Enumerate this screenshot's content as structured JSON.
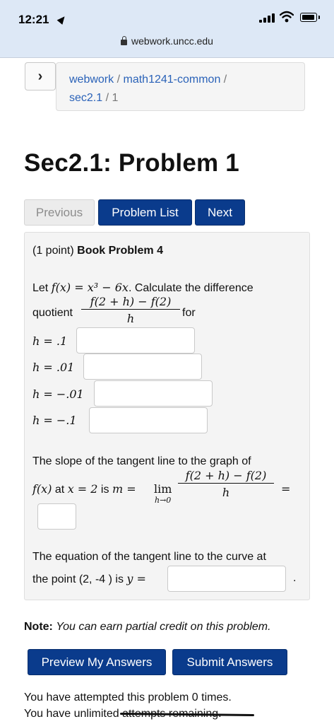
{
  "status_bar": {
    "time": "12:21"
  },
  "browser": {
    "url": "webwork.uncc.edu"
  },
  "breadcrumb": {
    "part1": "webwork",
    "part2": "math1241-common",
    "part3": "sec2.1",
    "part4": "1",
    "sep": "/"
  },
  "page": {
    "title": "Sec2.1: Problem 1"
  },
  "nav": {
    "previous": "Previous",
    "problem_list": "Problem List",
    "next": "Next"
  },
  "problem": {
    "points": "(1 point)",
    "name": "Book Problem 4",
    "let": "Let",
    "function": "f(x) = x³ − 6x",
    "calc": ". Calculate the difference",
    "quotient": "quotient",
    "frac_num": "f(2 + h) − f(2)",
    "frac_den": "h",
    "for": "for",
    "h_values": [
      "h = .1",
      "h = .01",
      "h = −.01",
      "h = −.1"
    ],
    "slope_line1": "The slope of the tangent line to the graph of",
    "fx": "f(x)",
    "at": "at",
    "x_eq": "x = 2",
    "is": "is",
    "m_eq": "m = ",
    "lim": "lim",
    "lim_sub": "h→0",
    "equals": "=",
    "tangent_line1": "The equation of the tangent line to the curve at",
    "tangent_line2": "the point (2, -4 ) is",
    "y_eq": "y =",
    "period": "."
  },
  "footer": {
    "note_label": "Note:",
    "note_text": "You can earn partial credit on this problem.",
    "preview_button": "Preview My Answers",
    "submit_button": "Submit Answers",
    "attempted": "You have attempted this problem 0 times.",
    "unlimited": "You have unlimited attempts remaining."
  }
}
